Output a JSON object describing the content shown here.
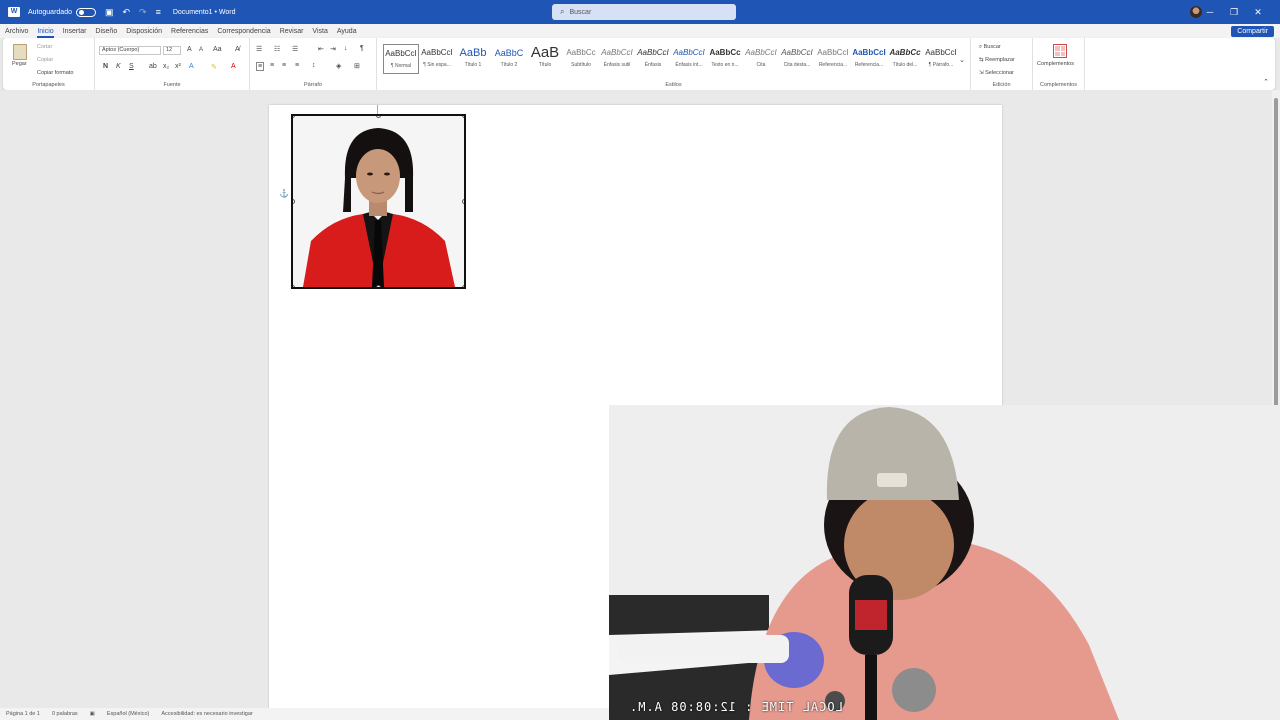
{
  "titlebar": {
    "autosave_label": "Autoguardado",
    "doc_title": "Documento1 • Word",
    "search_placeholder": "Buscar"
  },
  "menu": {
    "tabs": [
      "Archivo",
      "Inicio",
      "Insertar",
      "Diseño",
      "Disposición",
      "Referencias",
      "Correspondencia",
      "Revisar",
      "Vista",
      "Ayuda"
    ],
    "active_tab": "Inicio",
    "share_label": "Compartir"
  },
  "ribbon": {
    "clipboard": {
      "paste_label": "Pegar",
      "cut_label": "Cortar",
      "copy_label": "Copiar",
      "format_painter_label": "Copiar formato",
      "group_label": "Portapapeles"
    },
    "font": {
      "font_name": "Aptos (Cuerpo)",
      "font_size": "12",
      "bold": "N",
      "italic": "K",
      "underline": "S",
      "group_label": "Fuente"
    },
    "paragraph": {
      "group_label": "Párrafo"
    },
    "styles": {
      "items": [
        {
          "sample": "AaBbCcI",
          "name": "¶ Normal"
        },
        {
          "sample": "AaBbCcI",
          "name": "¶ Sin espa..."
        },
        {
          "sample": "AaBb",
          "name": "Título 1"
        },
        {
          "sample": "AaBbC",
          "name": "Título 2"
        },
        {
          "sample": "AaB",
          "name": "Título"
        },
        {
          "sample": "AaBbCc",
          "name": "Subtítulo"
        },
        {
          "sample": "AaBbCcI",
          "name": "Énfasis sutil"
        },
        {
          "sample": "AaBbCcI",
          "name": "Énfasis"
        },
        {
          "sample": "AaBbCcI",
          "name": "Énfasis int..."
        },
        {
          "sample": "AaBbCc",
          "name": "Texto en n..."
        },
        {
          "sample": "AaBbCcI",
          "name": "Cita"
        },
        {
          "sample": "AaBbCcI",
          "name": "Cita desta..."
        },
        {
          "sample": "AaBbCcI",
          "name": "Referencia..."
        },
        {
          "sample": "AaBbCcI",
          "name": "Referencia..."
        },
        {
          "sample": "AaBbCc",
          "name": "Título del..."
        },
        {
          "sample": "AaBbCcI",
          "name": "¶ Párrafo..."
        }
      ],
      "group_label": "Estilos"
    },
    "editing": {
      "find_label": "Buscar",
      "replace_label": "Reemplazar",
      "select_label": "Seleccionar",
      "group_label": "Edición"
    },
    "addins": {
      "button_label": "Complementos",
      "group_label": "Complementos"
    }
  },
  "statusbar": {
    "page": "Página 1 de 1",
    "words": "0 palabras",
    "language": "Español (México)",
    "accessibility": "Accesibilidad: es necesario investigar"
  },
  "webcam": {
    "timestamp": "LOCAL TIME : 12:08:08 A.M."
  },
  "colors": {
    "brand": "#1f56b5",
    "suit_red": "#d81b1b"
  }
}
